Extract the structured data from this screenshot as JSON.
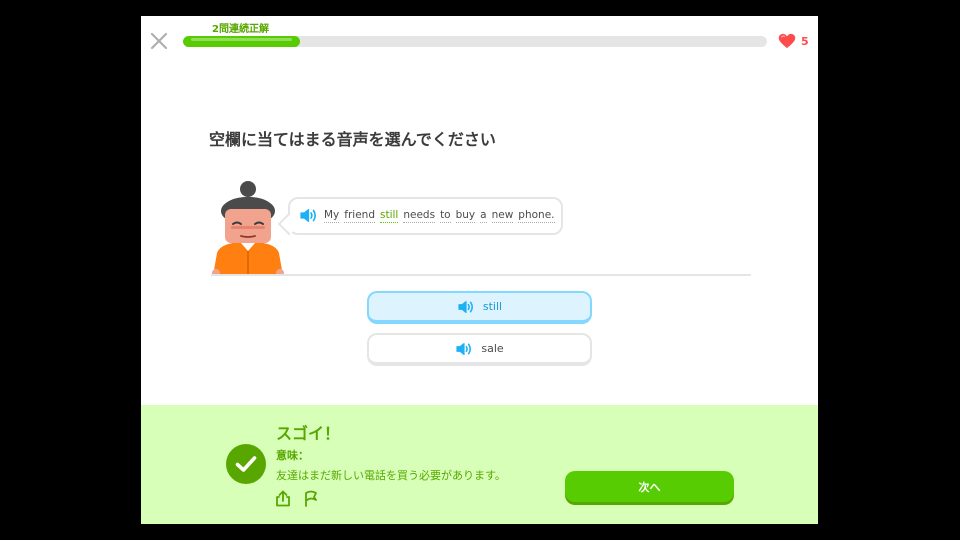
{
  "header": {
    "streak_label": "2問連続正解",
    "progress_fraction": 0.2,
    "hearts_count": "5"
  },
  "prompt": "空欄に当てはまる音声を選んでください",
  "sentence": [
    "My",
    "friend",
    "still",
    "needs",
    "to",
    "buy",
    "a",
    "new",
    "phone."
  ],
  "highlighted_word": "still",
  "choices": [
    {
      "label": "still",
      "selected": true
    },
    {
      "label": "sale",
      "selected": false
    }
  ],
  "feedback": {
    "title": "スゴイ！",
    "meaning_label": "意味：",
    "meaning_text": "友達はまだ新しい電話を買う必要があります。",
    "next_label": "次へ"
  },
  "colors": {
    "green": "#58cc02",
    "green_dark": "#58a700",
    "feedback_bg": "#d7ffb8",
    "selected_bg": "#ddf4ff",
    "audio_blue": "#1cb0f6",
    "heart_red": "#ff4b4b"
  },
  "icons": [
    "close-icon",
    "heart-icon",
    "speaker-icon",
    "check-icon",
    "share-icon",
    "flag-icon"
  ]
}
